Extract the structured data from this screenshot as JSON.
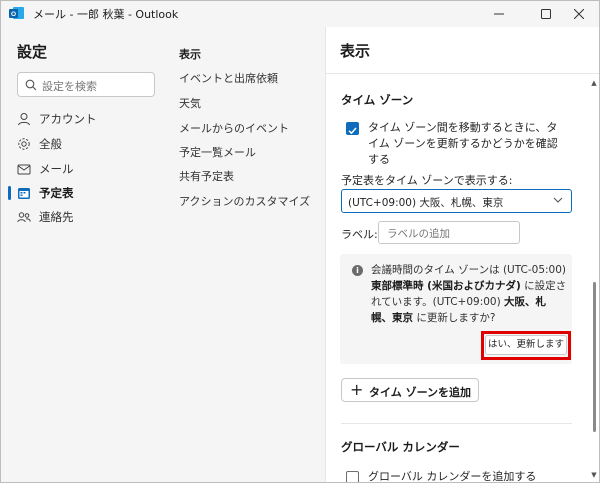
{
  "window": {
    "title": "メール - 一郎 秋葉 - Outlook",
    "minimize_icon": "minimize-icon",
    "maximize_icon": "maximize-icon",
    "close_icon": "close-icon"
  },
  "sidebar": {
    "title": "設定",
    "search_placeholder": "設定を検索",
    "items": [
      {
        "label": "アカウント",
        "icon": "person-icon"
      },
      {
        "label": "全般",
        "icon": "gear-icon"
      },
      {
        "label": "メール",
        "icon": "mail-icon"
      },
      {
        "label": "予定表",
        "icon": "calendar-icon",
        "active": true
      },
      {
        "label": "連絡先",
        "icon": "people-icon"
      }
    ]
  },
  "subnav": {
    "items": [
      {
        "label": "表示",
        "active": true
      },
      {
        "label": "イベントと出席依頼"
      },
      {
        "label": "天気"
      },
      {
        "label": "メールからのイベント"
      },
      {
        "label": "予定一覧メール"
      },
      {
        "label": "共有予定表"
      },
      {
        "label": "アクションのカスタマイズ"
      }
    ]
  },
  "panel": {
    "header": "表示",
    "timezone": {
      "section_title": "タイム ゾーン",
      "checkbox_label": "タイム ゾーン間を移動するときに、タイム ゾーンを更新するかどうかを確認する",
      "checkbox_checked": true,
      "display_label": "予定表をタイム ゾーンで表示する:",
      "display_value": "(UTC+09:00) 大阪、札幌、東京",
      "label_label": "ラベル:",
      "label_placeholder": "ラベルの追加",
      "info": {
        "t1": "会議時間のタイム ゾーンは (UTC-05:00) ",
        "b1": "東部標準時 (米国およびカナダ)",
        "t2": " に設定されています。(UTC+09:00) ",
        "b2": "大阪、札幌、東京",
        "t3": " に更新しますか?"
      },
      "yes_button": "はい、更新します",
      "add_button": "タイム ゾーンを追加"
    },
    "global_calendar": {
      "section_title": "グローバル カレンダー",
      "checkbox_label": "グローバル カレンダーを追加する",
      "checkbox_checked": false
    }
  },
  "colors": {
    "accent": "#0f6cbd",
    "highlight_border": "#e00000"
  }
}
